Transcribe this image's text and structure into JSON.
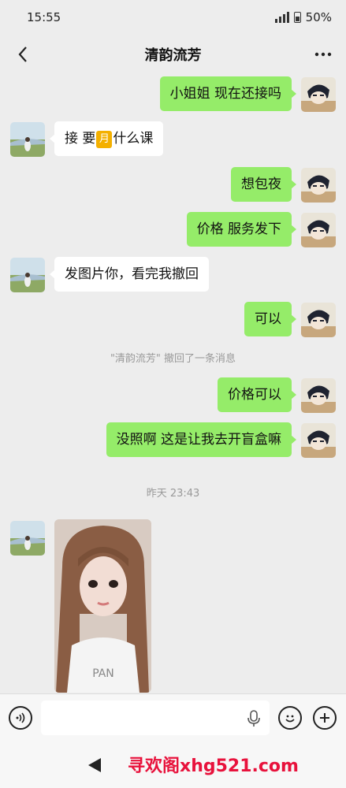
{
  "status": {
    "time": "15:55",
    "battery": "50%"
  },
  "header": {
    "title": "清韵流芳"
  },
  "messages": {
    "m1": "小姐姐 现在还接吗",
    "m2_pre": "接 要",
    "m2_emoji": "月",
    "m2_post": "什么课",
    "m3": "想包夜",
    "m4": "价格 服务发下",
    "m5": "发图片你，看完我撤回",
    "m6": "可以",
    "m7": "价格可以",
    "m8": "没照啊 这是让我去开盲盒嘛"
  },
  "system": {
    "recall": "\"清韵流芳\" 撤回了一条消息",
    "timestamp": "昨天 23:43"
  },
  "input": {
    "value": "",
    "placeholder": ""
  },
  "watermark": "寻欢阁xhg521.com",
  "icons": [
    "back-arrow-icon",
    "more-icon",
    "voice-icon",
    "mic-icon",
    "emoji-icon",
    "add-icon",
    "nav-back-icon"
  ]
}
